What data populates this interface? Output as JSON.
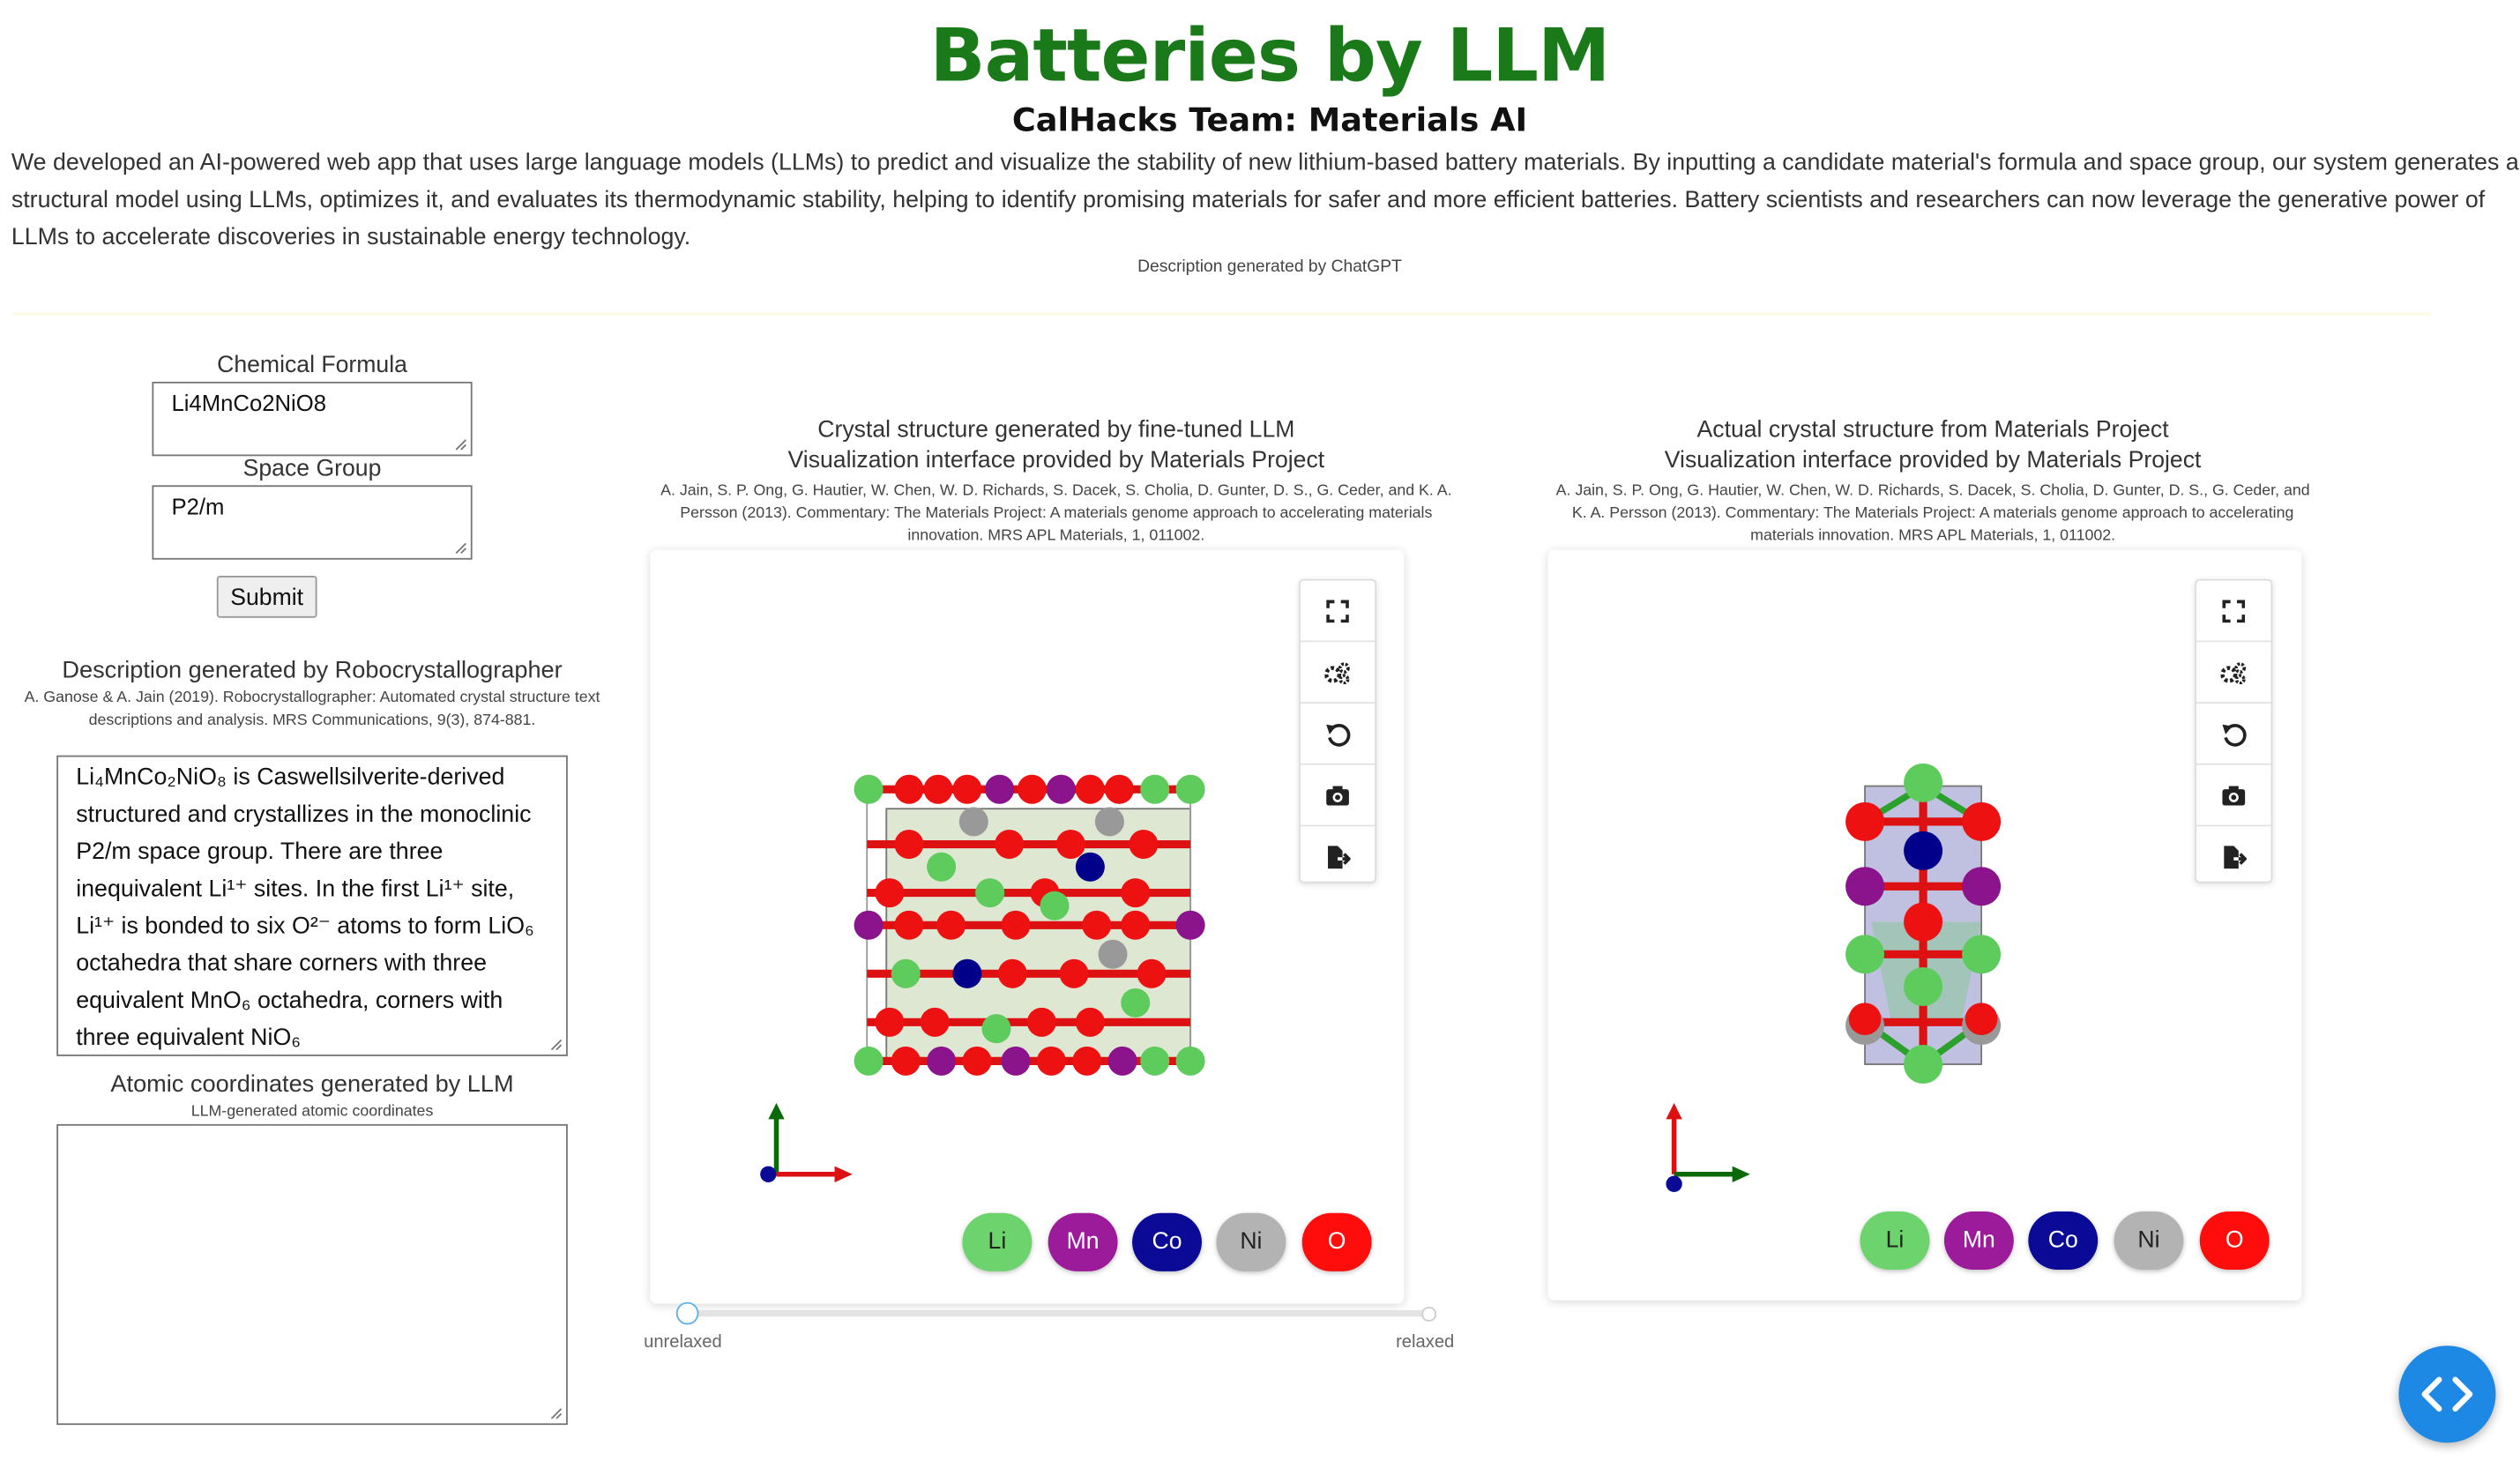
{
  "header": {
    "title": "Batteries by LLM",
    "subtitle": "CalHacks Team: Materials AI",
    "intro": "We developed an AI-powered web app that uses large language models (LLMs) to predict and visualize the stability of new lithium-based battery materials. By inputting a candidate material's formula and space group, our system generates a structural model using LLMs, optimizes it, and evaluates its thermodynamic stability, helping to identify promising materials for safer and more efficient batteries. Battery scientists and researchers can now leverage the generative power of LLMs to accelerate discoveries in sustainable energy technology.",
    "intro_credit": "Description generated by ChatGPT"
  },
  "form": {
    "formula_label": "Chemical Formula",
    "formula_value": "Li4MnCo2NiO8",
    "spacegroup_label": "Space Group",
    "spacegroup_value": "P2/m",
    "submit_label": "Submit"
  },
  "description": {
    "title": "Description generated by Robocrystallographer",
    "citation": "A. Ganose & A. Jain (2019). Robocrystallographer: Automated crystal structure text descriptions and analysis. MRS Communications, 9(3), 874-881.",
    "text": "Li₄MnCo₂NiO₈ is Caswellsilverite-derived structured and crystallizes in the monoclinic P2/m space group. There are three inequivalent Li¹⁺ sites. In the first Li¹⁺ site, Li¹⁺ is bonded to six O²⁻ atoms to form LiO₆ octahedra that share corners with three equivalent MnO₆ octahedra, corners with three equivalent NiO₆"
  },
  "coords": {
    "title": "Atomic coordinates generated by LLM",
    "subtitle": "LLM-generated atomic coordinates",
    "value": ""
  },
  "viewer_left": {
    "title": "Crystal structure generated by fine-tuned LLM",
    "subtitle": "Visualization interface provided by Materials Project",
    "citation": "A. Jain, S. P. Ong, G. Hautier, W. Chen, W. D. Richards, S. Dacek, S. Cholia, D. Gunter, D. S., G. Ceder, and K. A. Persson (2013). Commentary: The Materials Project: A materials genome approach to accelerating materials innovation. MRS APL Materials, 1, 011002.",
    "slider_left": "unrelaxed",
    "slider_right": "relaxed",
    "slider_value": 0
  },
  "viewer_right": {
    "title": "Actual crystal structure from Materials Project",
    "subtitle": "Visualization interface provided by Materials Project",
    "citation": "A. Jain, S. P. Ong, G. Hautier, W. Chen, W. D. Richards, S. Dacek, S. Cholia, D. Gunter, D. S., G. Ceder, and K. A. Persson (2013). Commentary: The Materials Project: A materials genome approach to accelerating materials innovation. MRS APL Materials, 1, 011002."
  },
  "toolbar_icons": [
    "fullscreen-icon",
    "settings-icon",
    "reset-icon",
    "camera-icon",
    "export-icon"
  ],
  "legend": [
    {
      "label": "Li",
      "color": "#6dd46d",
      "text": "#222222"
    },
    {
      "label": "Mn",
      "color": "#9b1b9b",
      "text": "#ffffff"
    },
    {
      "label": "Co",
      "color": "#0a0a96",
      "text": "#ffffff"
    },
    {
      "label": "Ni",
      "color": "#b3b3b3",
      "text": "#222222"
    },
    {
      "label": "O",
      "color": "#ff0d0d",
      "text": "#ffffff"
    }
  ],
  "colors": {
    "title": "#1a7a1a",
    "fab": "#1e88e5"
  }
}
